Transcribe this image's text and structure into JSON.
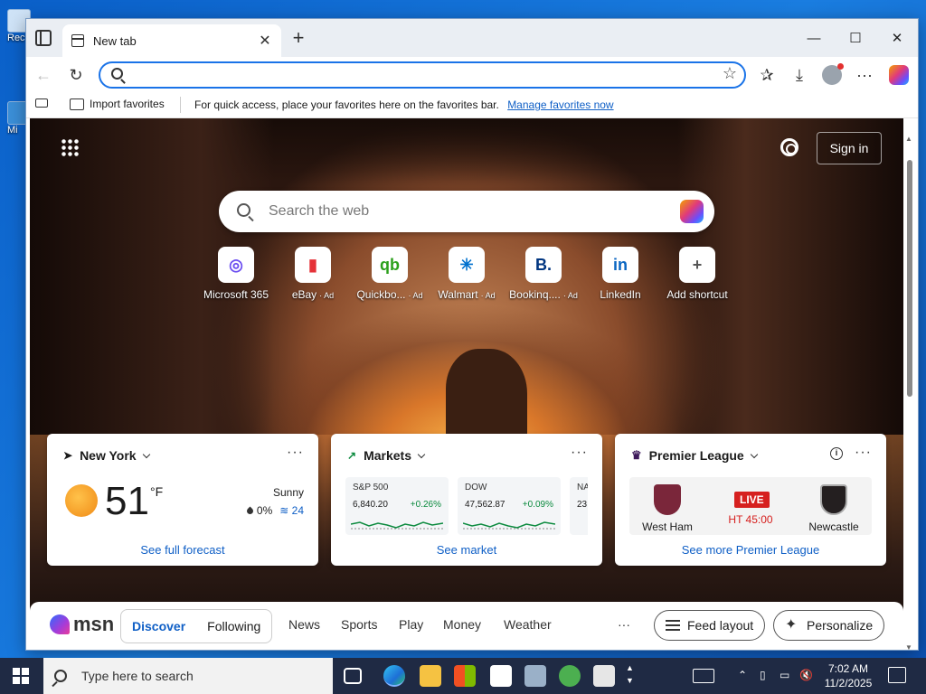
{
  "desktop": {
    "icon1_label": "Rec",
    "icon2_label": "Mi"
  },
  "browser": {
    "tab_title": "New tab",
    "address_value": "",
    "favorites_bar": {
      "import_label": "Import favorites",
      "message": "For quick access, place your favorites here on the favorites bar.",
      "manage_link": "Manage favorites now"
    }
  },
  "ntp": {
    "signin_label": "Sign in",
    "search_placeholder": "Search the web",
    "shortcuts": [
      {
        "label": "Microsoft 365",
        "ad": "",
        "glyph": "◎",
        "color": "#6b4ef0"
      },
      {
        "label": "eBay",
        "ad": "Ad",
        "glyph": "▮",
        "color": "#e53238"
      },
      {
        "label": "Quickbo...",
        "ad": "Ad",
        "glyph": "qb",
        "color": "#2ca01c"
      },
      {
        "label": "Walmart",
        "ad": "Ad",
        "glyph": "✳",
        "color": "#0071ce"
      },
      {
        "label": "Bookinq....",
        "ad": "Ad",
        "glyph": "B.",
        "color": "#003580"
      },
      {
        "label": "LinkedIn",
        "ad": "",
        "glyph": "in",
        "color": "#0a66c2"
      },
      {
        "label": "Add shortcut",
        "ad": "",
        "glyph": "+",
        "color": "#555555"
      }
    ],
    "weather": {
      "location": "New York",
      "temp": "51",
      "unit": "°F",
      "condition": "Sunny",
      "precip": "0%",
      "wind": "24",
      "footer": "See full forecast"
    },
    "markets": {
      "title": "Markets",
      "items": [
        {
          "name": "S&P 500",
          "value": "6,840.20",
          "change": "+0.26%"
        },
        {
          "name": "DOW",
          "value": "47,562.87",
          "change": "+0.09%"
        },
        {
          "name": "NA",
          "value": "23,",
          "change": ""
        }
      ],
      "footer": "See market"
    },
    "league": {
      "title": "Premier League",
      "home": "West Ham",
      "away": "Newcastle",
      "status": "LIVE",
      "time": "HT 45:00",
      "footer": "See more Premier League"
    },
    "feedbar": {
      "logo": "msn",
      "tabs": [
        "Discover",
        "Following"
      ],
      "nav": [
        "News",
        "Sports",
        "Play",
        "Money",
        "Weather"
      ],
      "more": "···",
      "feed_layout": "Feed layout",
      "personalize": "Personalize"
    }
  },
  "taskbar": {
    "search_placeholder": "Type here to search",
    "time": "7:02 AM",
    "date": "11/2/2025"
  }
}
